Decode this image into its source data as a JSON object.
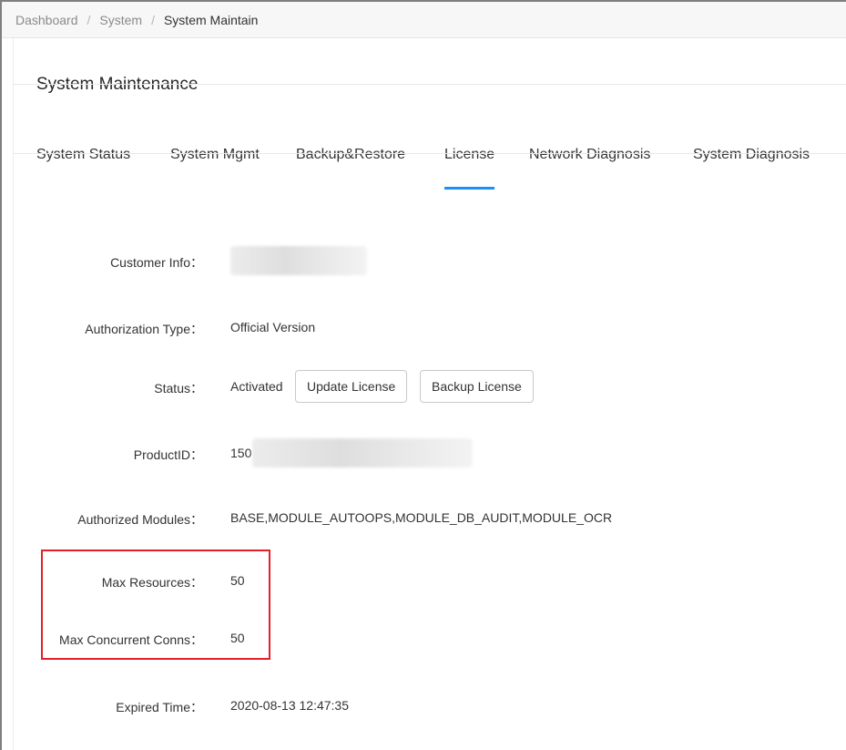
{
  "breadcrumb": {
    "items": [
      "Dashboard",
      "System",
      "System Maintain"
    ],
    "separator": "/"
  },
  "page": {
    "title": "System Maintenance"
  },
  "tabs": [
    {
      "label": "System Status",
      "active": false
    },
    {
      "label": "System Mgmt",
      "active": false
    },
    {
      "label": "Backup&Restore",
      "active": false
    },
    {
      "label": "License",
      "active": true
    },
    {
      "label": "Network Diagnosis",
      "active": false
    },
    {
      "label": "System Diagnosis",
      "active": false
    }
  ],
  "license": {
    "customer_info": {
      "label": "Customer Info：",
      "value": ""
    },
    "authorization_type": {
      "label": "Authorization Type：",
      "value": "Official Version"
    },
    "status": {
      "label": "Status：",
      "value": "Activated",
      "update_button": "Update License",
      "backup_button": "Backup License"
    },
    "product_id": {
      "label": "ProductID：",
      "value": "150"
    },
    "authorized_modules": {
      "label": "Authorized Modules：",
      "value": "BASE,MODULE_AUTOOPS,MODULE_DB_AUDIT,MODULE_OCR"
    },
    "max_resources": {
      "label": "Max Resources：",
      "value": "50"
    },
    "max_concurrent_conns": {
      "label": "Max Concurrent Conns：",
      "value": "50"
    },
    "expired_time": {
      "label": "Expired Time：",
      "value": "2020-08-13 12:47:35"
    }
  },
  "colors": {
    "accent": "#1890ff",
    "highlight": "#e4202a"
  }
}
